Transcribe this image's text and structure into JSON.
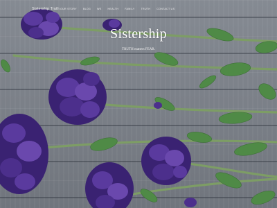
{
  "header": {
    "brand": "Sistership Truth",
    "nav": [
      "OUR STORY",
      "BLOG",
      "WE",
      "HEALTH",
      "FAMILY",
      "TRUTH",
      "CONTACT US"
    ]
  },
  "hero": {
    "title": "Sistership",
    "tagline": "TRUTH matters FEAR."
  },
  "colors": {
    "background": "#7d8289",
    "petal": "#5a3a9e",
    "petal_dark": "#3a2272",
    "leaf": "#4f8a46",
    "stem": "#7d9d65",
    "text": "#ffffff"
  }
}
